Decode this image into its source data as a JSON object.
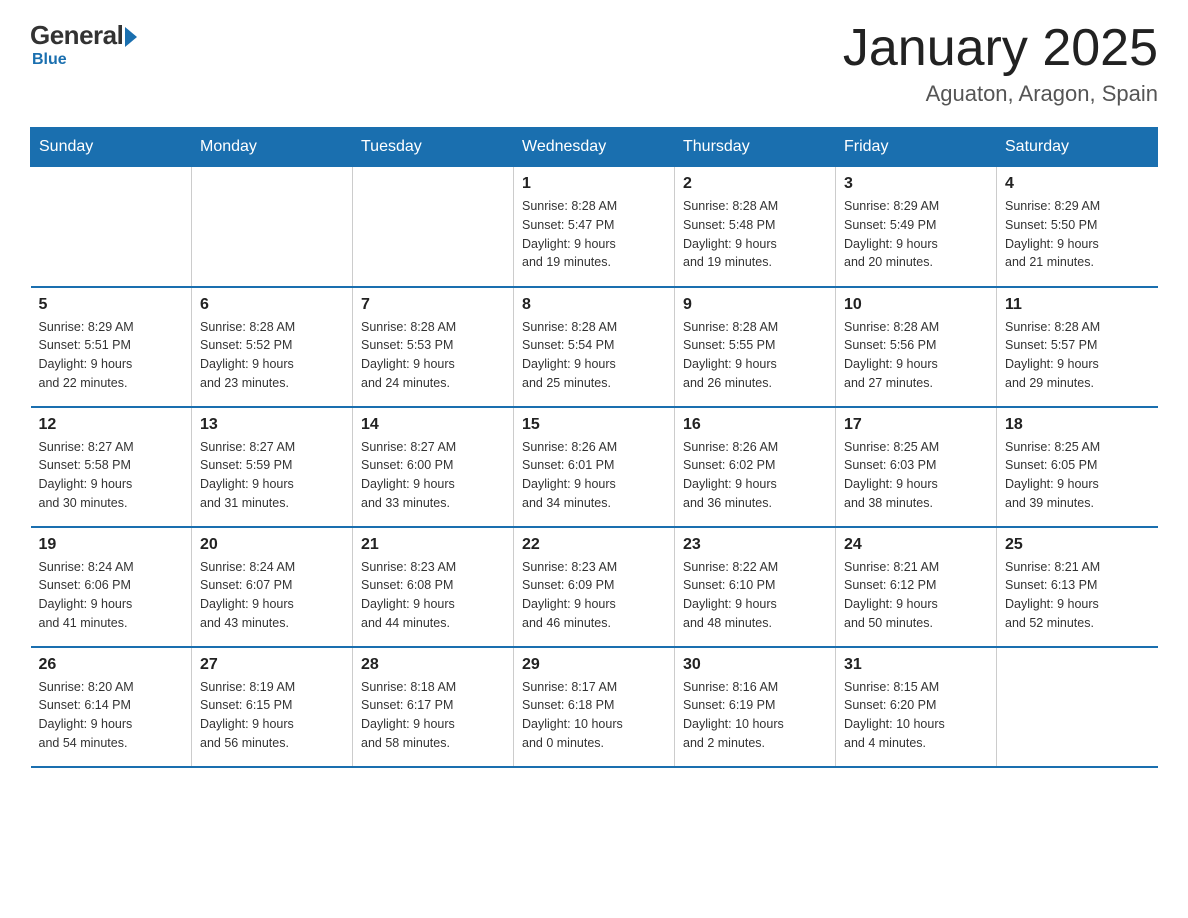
{
  "logo": {
    "general": "General",
    "blue": "Blue",
    "arrow": "▶"
  },
  "title": "January 2025",
  "subtitle": "Aguaton, Aragon, Spain",
  "days_of_week": [
    "Sunday",
    "Monday",
    "Tuesday",
    "Wednesday",
    "Thursday",
    "Friday",
    "Saturday"
  ],
  "weeks": [
    [
      {
        "day": "",
        "info": ""
      },
      {
        "day": "",
        "info": ""
      },
      {
        "day": "",
        "info": ""
      },
      {
        "day": "1",
        "info": "Sunrise: 8:28 AM\nSunset: 5:47 PM\nDaylight: 9 hours\nand 19 minutes."
      },
      {
        "day": "2",
        "info": "Sunrise: 8:28 AM\nSunset: 5:48 PM\nDaylight: 9 hours\nand 19 minutes."
      },
      {
        "day": "3",
        "info": "Sunrise: 8:29 AM\nSunset: 5:49 PM\nDaylight: 9 hours\nand 20 minutes."
      },
      {
        "day": "4",
        "info": "Sunrise: 8:29 AM\nSunset: 5:50 PM\nDaylight: 9 hours\nand 21 minutes."
      }
    ],
    [
      {
        "day": "5",
        "info": "Sunrise: 8:29 AM\nSunset: 5:51 PM\nDaylight: 9 hours\nand 22 minutes."
      },
      {
        "day": "6",
        "info": "Sunrise: 8:28 AM\nSunset: 5:52 PM\nDaylight: 9 hours\nand 23 minutes."
      },
      {
        "day": "7",
        "info": "Sunrise: 8:28 AM\nSunset: 5:53 PM\nDaylight: 9 hours\nand 24 minutes."
      },
      {
        "day": "8",
        "info": "Sunrise: 8:28 AM\nSunset: 5:54 PM\nDaylight: 9 hours\nand 25 minutes."
      },
      {
        "day": "9",
        "info": "Sunrise: 8:28 AM\nSunset: 5:55 PM\nDaylight: 9 hours\nand 26 minutes."
      },
      {
        "day": "10",
        "info": "Sunrise: 8:28 AM\nSunset: 5:56 PM\nDaylight: 9 hours\nand 27 minutes."
      },
      {
        "day": "11",
        "info": "Sunrise: 8:28 AM\nSunset: 5:57 PM\nDaylight: 9 hours\nand 29 minutes."
      }
    ],
    [
      {
        "day": "12",
        "info": "Sunrise: 8:27 AM\nSunset: 5:58 PM\nDaylight: 9 hours\nand 30 minutes."
      },
      {
        "day": "13",
        "info": "Sunrise: 8:27 AM\nSunset: 5:59 PM\nDaylight: 9 hours\nand 31 minutes."
      },
      {
        "day": "14",
        "info": "Sunrise: 8:27 AM\nSunset: 6:00 PM\nDaylight: 9 hours\nand 33 minutes."
      },
      {
        "day": "15",
        "info": "Sunrise: 8:26 AM\nSunset: 6:01 PM\nDaylight: 9 hours\nand 34 minutes."
      },
      {
        "day": "16",
        "info": "Sunrise: 8:26 AM\nSunset: 6:02 PM\nDaylight: 9 hours\nand 36 minutes."
      },
      {
        "day": "17",
        "info": "Sunrise: 8:25 AM\nSunset: 6:03 PM\nDaylight: 9 hours\nand 38 minutes."
      },
      {
        "day": "18",
        "info": "Sunrise: 8:25 AM\nSunset: 6:05 PM\nDaylight: 9 hours\nand 39 minutes."
      }
    ],
    [
      {
        "day": "19",
        "info": "Sunrise: 8:24 AM\nSunset: 6:06 PM\nDaylight: 9 hours\nand 41 minutes."
      },
      {
        "day": "20",
        "info": "Sunrise: 8:24 AM\nSunset: 6:07 PM\nDaylight: 9 hours\nand 43 minutes."
      },
      {
        "day": "21",
        "info": "Sunrise: 8:23 AM\nSunset: 6:08 PM\nDaylight: 9 hours\nand 44 minutes."
      },
      {
        "day": "22",
        "info": "Sunrise: 8:23 AM\nSunset: 6:09 PM\nDaylight: 9 hours\nand 46 minutes."
      },
      {
        "day": "23",
        "info": "Sunrise: 8:22 AM\nSunset: 6:10 PM\nDaylight: 9 hours\nand 48 minutes."
      },
      {
        "day": "24",
        "info": "Sunrise: 8:21 AM\nSunset: 6:12 PM\nDaylight: 9 hours\nand 50 minutes."
      },
      {
        "day": "25",
        "info": "Sunrise: 8:21 AM\nSunset: 6:13 PM\nDaylight: 9 hours\nand 52 minutes."
      }
    ],
    [
      {
        "day": "26",
        "info": "Sunrise: 8:20 AM\nSunset: 6:14 PM\nDaylight: 9 hours\nand 54 minutes."
      },
      {
        "day": "27",
        "info": "Sunrise: 8:19 AM\nSunset: 6:15 PM\nDaylight: 9 hours\nand 56 minutes."
      },
      {
        "day": "28",
        "info": "Sunrise: 8:18 AM\nSunset: 6:17 PM\nDaylight: 9 hours\nand 58 minutes."
      },
      {
        "day": "29",
        "info": "Sunrise: 8:17 AM\nSunset: 6:18 PM\nDaylight: 10 hours\nand 0 minutes."
      },
      {
        "day": "30",
        "info": "Sunrise: 8:16 AM\nSunset: 6:19 PM\nDaylight: 10 hours\nand 2 minutes."
      },
      {
        "day": "31",
        "info": "Sunrise: 8:15 AM\nSunset: 6:20 PM\nDaylight: 10 hours\nand 4 minutes."
      },
      {
        "day": "",
        "info": ""
      }
    ]
  ]
}
